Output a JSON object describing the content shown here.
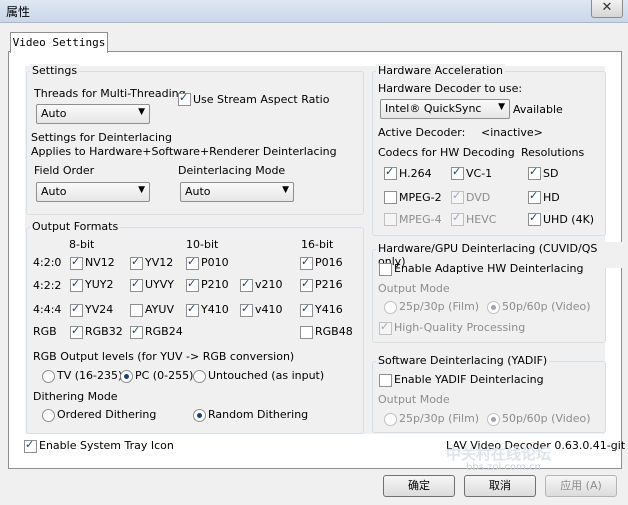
{
  "window": {
    "title": "属性",
    "close": "✕"
  },
  "tab": {
    "label": "Video Settings"
  },
  "settings": {
    "title": "Settings",
    "threads_label": "Threads for Multi-Threading",
    "threads_value": "Auto",
    "stream_aspect_label": "Use Stream Aspect Ratio",
    "deint_title": "Settings for Deinterlacing",
    "deint_desc": "Applies to Hardware+Software+Renderer Deinterlacing",
    "field_order_label": "Field Order",
    "field_order_value": "Auto",
    "deint_mode_label": "Deinterlacing Mode",
    "deint_mode_value": "Auto"
  },
  "output": {
    "title": "Output Formats",
    "h8": "8-bit",
    "h10": "10-bit",
    "h16": "16-bit",
    "r420": "4:2:0",
    "r422": "4:2:2",
    "r444": "4:4:4",
    "rgb": "RGB",
    "nv12": "NV12",
    "yv12": "YV12",
    "p010": "P010",
    "p016": "P016",
    "yuy2": "YUY2",
    "uyvy": "UYVY",
    "p210": "P210",
    "v210": "v210",
    "p216": "P216",
    "yv24": "YV24",
    "ayuv": "AYUV",
    "y410": "Y410",
    "v410": "v410",
    "y416": "Y416",
    "rgb32": "RGB32",
    "rgb24": "RGB24",
    "rgb48": "RGB48",
    "levels_title": "RGB Output levels (for YUV -> RGB conversion)",
    "tv": "TV (16-235)",
    "pc": "PC (0-255)",
    "untouched": "Untouched (as input)",
    "dither_title": "Dithering Mode",
    "ordered": "Ordered Dithering",
    "random": "Random Dithering"
  },
  "tray": "Enable System Tray Icon",
  "hw": {
    "title": "Hardware Acceleration",
    "decoder_label": "Hardware Decoder to use:",
    "decoder_value": "Intel® QuickSync",
    "available": "Available",
    "active_label": "Active Decoder:",
    "active_value": "<inactive>",
    "codecs_label": "Codecs for HW Decoding",
    "res_label": "Resolutions",
    "h264": "H.264",
    "vc1": "VC-1",
    "sd": "SD",
    "mpeg2": "MPEG-2",
    "dvd": "DVD",
    "hd": "HD",
    "mpeg4": "MPEG-4",
    "hevc": "HEVC",
    "uhd": "UHD (4K)"
  },
  "gpu_deint": {
    "title": "Hardware/GPU Deinterlacing (CUVID/QS only)",
    "enable": "Enable Adaptive HW Deinterlacing",
    "mode": "Output Mode",
    "film": "25p/30p (Film)",
    "video": "50p/60p (Video)",
    "hq": "High-Quality Processing"
  },
  "sw_deint": {
    "title": "Software Deinterlacing (YADIF)",
    "enable": "Enable YADIF Deinterlacing",
    "mode": "Output Mode",
    "film": "25p/30p (Film)",
    "video": "50p/60p (Video)"
  },
  "version": "LAV Video Decoder 0.63.0.41-git",
  "watermark": {
    "text1": "中关村在线论坛",
    "text2": "bbs.zol.com.cn"
  },
  "buttons": {
    "ok": "确定",
    "cancel": "取消",
    "apply": "应用 (A)"
  }
}
